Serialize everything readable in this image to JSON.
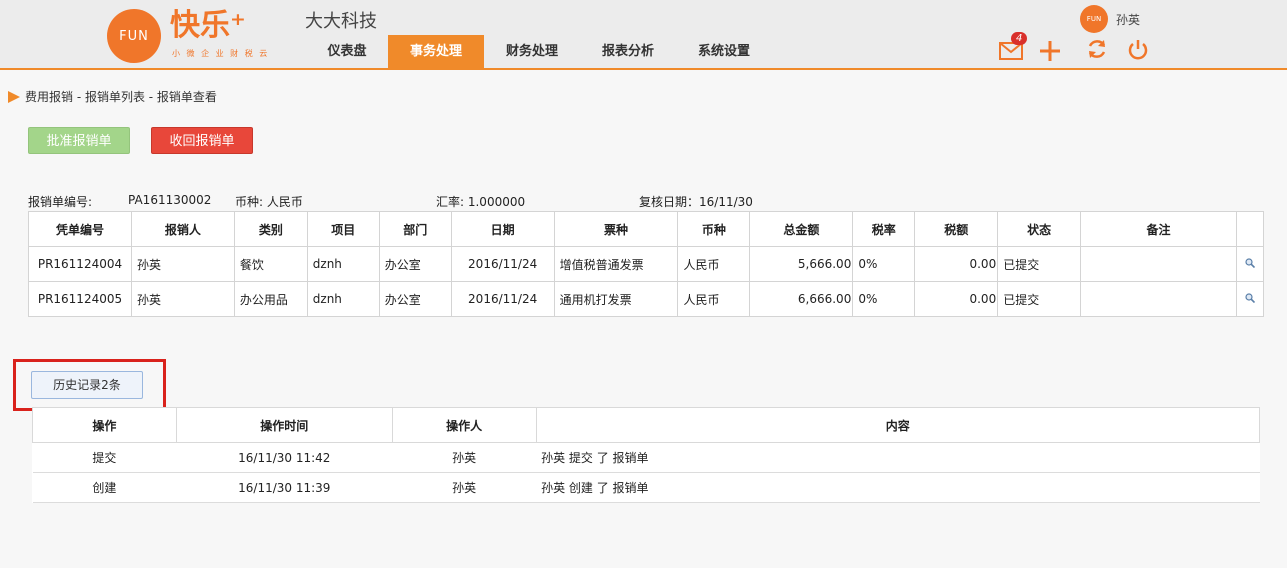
{
  "header": {
    "logo_text": "FUN",
    "brand": "快乐⁺",
    "brand_sub": "小 微 企 业 财 税 云",
    "company": "大大科技",
    "nav": [
      {
        "label": "仪表盘",
        "active": false
      },
      {
        "label": "事务处理",
        "active": true
      },
      {
        "label": "财务处理",
        "active": false
      },
      {
        "label": "报表分析",
        "active": false
      },
      {
        "label": "系统设置",
        "active": false
      }
    ],
    "mail_count": "4",
    "icons": [
      "mail-icon",
      "plus-icon",
      "refresh-icon",
      "power-icon"
    ],
    "avatar_text": "FUN",
    "user_name": "孙英",
    "accent_color": "#f08a2a"
  },
  "breadcrumb": "费用报销 - 报销单列表 - 报销单查看",
  "actions": {
    "approve_label": "批准报销单",
    "recall_label": "收回报销单"
  },
  "info": {
    "no_label": "报销单编号:",
    "no_value": "PA161130002",
    "currency": "币种: 人民币",
    "rate": "汇率: 1.000000",
    "review_date": "复核日期：16/11/30"
  },
  "table": {
    "headers": [
      "凭单编号",
      "报销人",
      "类别",
      "项目",
      "部门",
      "日期",
      "票种",
      "币种",
      "总金额",
      "税率",
      "税额",
      "状态",
      "备注",
      ""
    ],
    "rows": [
      [
        "PR161124004",
        "孙英",
        "餐饮",
        "dznh",
        "办公室",
        "2016/11/24",
        "增值税普通发票",
        "人民币",
        "5,666.00",
        "0%",
        "0.00",
        "已提交",
        ""
      ],
      [
        "PR161124005",
        "孙英",
        "办公用品",
        "dznh",
        "办公室",
        "2016/11/24",
        "通用机打发票",
        "人民币",
        "6,666.00",
        "0%",
        "0.00",
        "已提交",
        ""
      ]
    ]
  },
  "history": {
    "button_label": "历史记录2条",
    "headers": [
      "操作",
      "操作时间",
      "操作人",
      "内容"
    ],
    "rows": [
      [
        "提交",
        "16/11/30 11:42",
        "孙英",
        "孙英 提交 了 报销单"
      ],
      [
        "创建",
        "16/11/30 11:39",
        "孙英",
        "孙英 创建 了 报销单"
      ]
    ]
  }
}
